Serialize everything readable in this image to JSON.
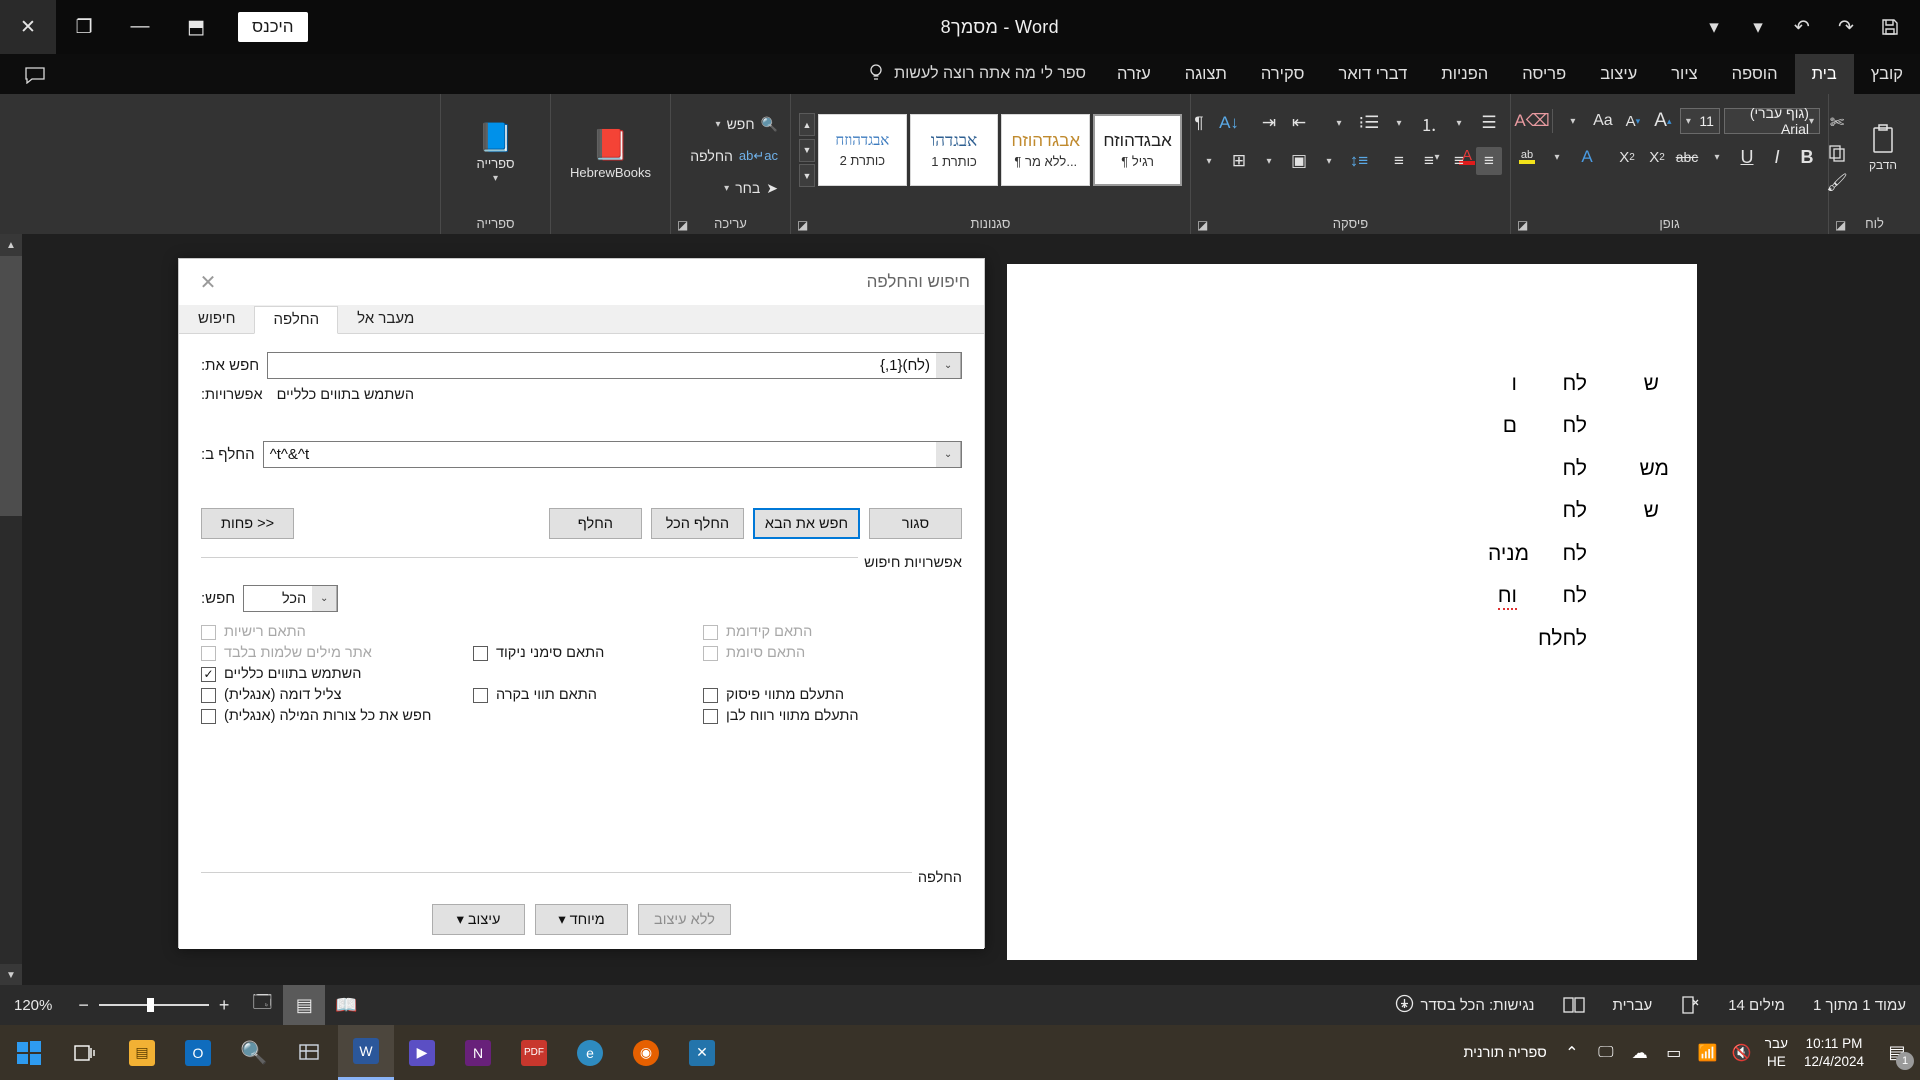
{
  "titlebar": {
    "title": "מסמך8 - Word",
    "signin_label": "היכנס",
    "buttons": {
      "close": "✕",
      "restore": "❐",
      "minimize": "—",
      "ribbon_display": "⬒"
    },
    "qat": {
      "save": "save-icon",
      "undo": "↶",
      "undo_drop": "▾",
      "redo": "↷",
      "customize": "▾"
    },
    "comment_icon": "comment-icon"
  },
  "ribbon_tabs": {
    "items": [
      {
        "label": "קובץ",
        "active": false
      },
      {
        "label": "בית",
        "active": true
      },
      {
        "label": "הוספה",
        "active": false
      },
      {
        "label": "ציור",
        "active": false
      },
      {
        "label": "עיצוב",
        "active": false
      },
      {
        "label": "פריסה",
        "active": false
      },
      {
        "label": "הפניות",
        "active": false
      },
      {
        "label": "דברי דואר",
        "active": false
      },
      {
        "label": "סקירה",
        "active": false
      },
      {
        "label": "תצוגה",
        "active": false
      },
      {
        "label": "עזרה",
        "active": false
      }
    ],
    "tellme": "ספר לי מה אתה רוצה לעשות"
  },
  "ribbon": {
    "groups": {
      "clipboard": {
        "label": "לוח",
        "paste_label": "הדבק",
        "cut_icon": "scissors-icon",
        "copy_icon": "copy-icon",
        "format_painter_icon": "format-painter-icon"
      },
      "font": {
        "label": "גופן",
        "font_name": "(גוף עברי) Arial",
        "font_size": "11",
        "grow_font": "A",
        "shrink_font": "A",
        "change_case": "Aa",
        "clear_formatting": "clear-formatting-icon",
        "bold": "B",
        "italic": "I",
        "underline": "U",
        "strikethrough": "abc",
        "subscript": "X₂",
        "superscript": "X²",
        "text_effects": "A",
        "highlight": "ab",
        "font_color": "A"
      },
      "paragraph": {
        "label": "פיסקה",
        "bullets_icon": "bullets-icon",
        "numbering_icon": "numbering-icon",
        "multilevel_icon": "multilevel-list-icon",
        "decrease_indent_icon": "decrease-indent-icon",
        "increase_indent_icon": "increase-indent-icon",
        "sort_icon": "sort-icon",
        "marks_icon": "¶",
        "align_right_icon": "align-right-icon",
        "align_center_icon": "align-center-icon",
        "align_left_icon": "align-left-icon",
        "justify_icon": "justify-icon",
        "line_spacing_icon": "line-spacing-icon",
        "shading_icon": "shading-icon",
        "borders_icon": "borders-icon",
        "rtl_icon": "rtl-icon"
      },
      "styles": {
        "label": "סגנונות",
        "gallery": [
          {
            "preview": "אבגדהוזח",
            "name": "¶ רגיל",
            "selected": true
          },
          {
            "preview": "אבגדהוזח",
            "name": "¶ ללא מר...",
            "selected": false
          },
          {
            "preview": "אבגדהו",
            "name": "כותרת 1",
            "selected": false
          },
          {
            "preview": "אבגדהוזח",
            "name": "כותרת 2",
            "selected": false
          }
        ],
        "scroll_up": "▲",
        "scroll_down": "▼",
        "more": "▼"
      },
      "editing": {
        "label": "עריכה",
        "items": [
          {
            "label": "חפש",
            "icon": "search-icon",
            "has_chevron": true
          },
          {
            "label": "החלפה",
            "icon": "replace-icon",
            "has_chevron": false
          },
          {
            "label": "בחר",
            "icon": "select-icon",
            "has_chevron": true
          }
        ]
      },
      "hebrewbooks": {
        "label": "",
        "title": "HebrewBooks",
        "icon": "book-icon"
      },
      "library": {
        "label": "ספרייה",
        "title": "ספרייה",
        "icon": "word-library-icon",
        "chevron": "▾"
      }
    }
  },
  "document": {
    "lines": [
      {
        "c1": "ש",
        "c2": "לח",
        "c3": "ו",
        "squiggle": false
      },
      {
        "c1": "",
        "c2": "לח",
        "c3": "ם",
        "squiggle": false
      },
      {
        "c1": "מש",
        "c2": "לח",
        "c3": "",
        "squiggle": false
      },
      {
        "c1": "ש",
        "c2": "לח",
        "c3": "",
        "squiggle": false
      },
      {
        "c1": "",
        "c2": "לח",
        "c3": "מניה",
        "squiggle": false
      },
      {
        "c1": "",
        "c2": "לח",
        "c3": "וח",
        "squiggle": true
      },
      {
        "c1": "",
        "c2": "לחלח",
        "c3": "",
        "squiggle": false
      }
    ]
  },
  "dialog": {
    "title": "חיפוש והחלפה",
    "close_icon": "close-icon",
    "tabs": [
      {
        "label": "חיפוש",
        "active": false
      },
      {
        "label": "החלפה",
        "active": true
      },
      {
        "label": "מעבר אל",
        "active": false
      }
    ],
    "find": {
      "label": "חפש את:",
      "value": "(לח){1,}",
      "dropdown_icon": "chevron-down-icon"
    },
    "options": {
      "label": "אפשרויות:",
      "value": "השתמש בתווים כלליים"
    },
    "replace": {
      "label": "החלף ב:",
      "value": "^t^&^t",
      "dropdown_icon": "chevron-down-icon"
    },
    "buttons": {
      "less": "<< פחות",
      "replace": "החלף",
      "replace_all": "החלף הכל",
      "find_next": "חפש את הבא",
      "close": "סגור"
    },
    "search_options_legend": "אפשרויות חיפוש",
    "search_scope": {
      "label": "חפש:",
      "value": "הכל",
      "dropdown_icon": "chevron-down-icon"
    },
    "checkboxes": [
      {
        "label": "התאם רישיות",
        "checked": false,
        "disabled": true,
        "col": "right"
      },
      {
        "label": "התאם קידומת",
        "checked": false,
        "disabled": true,
        "col": "left"
      },
      {
        "label": "אתר מילים שלמות בלבד",
        "checked": false,
        "disabled": true,
        "col": "right"
      },
      {
        "label": "התאם סימני ניקוד",
        "checked": false,
        "disabled": false,
        "col": "mid"
      },
      {
        "label": "התאם סיומת",
        "checked": false,
        "disabled": true,
        "col": "left"
      },
      {
        "label": "השתמש בתווים כלליים",
        "checked": true,
        "disabled": false,
        "col": "right"
      },
      {
        "label": "צליל דומה (אנגלית)",
        "checked": false,
        "disabled": false,
        "col": "right"
      },
      {
        "label": "התאם תווי בקרה",
        "checked": false,
        "disabled": false,
        "col": "mid"
      },
      {
        "label": "התעלם מתווי פיסוק",
        "checked": false,
        "disabled": false,
        "col": "left"
      },
      {
        "label": "חפש את כל צורות המילה (אנגלית)",
        "checked": false,
        "disabled": false,
        "col": "right"
      },
      {
        "label": "התעלם מתווי רווח לבן",
        "checked": false,
        "disabled": false,
        "col": "left"
      }
    ],
    "replace_legend": "החלפה",
    "bottom_buttons": {
      "format": "עיצוב ▾",
      "special": "מיוחד ▾",
      "no_formatting": "ללא עיצוב"
    },
    "checked_mark": "✓"
  },
  "statusbar": {
    "page": "עמוד 1 מתוך 1",
    "words": "14 מילים",
    "proofing_icon": "proofing-icon",
    "language": "עברית",
    "focus_icon": "focus-mode-icon",
    "accessibility": "נגישות: הכל בסדר",
    "accessibility_icon": "accessibility-icon",
    "views": {
      "read_mode": "read-mode-icon",
      "print_layout": "print-layout-icon",
      "web_layout": "web-layout-icon"
    },
    "zoom_out": "−",
    "zoom_in": "+",
    "zoom_level": "120%"
  },
  "taskbar": {
    "start_icon": "windows-start-icon",
    "taskview_icon": "task-view-icon",
    "apps": [
      {
        "name": "file-explorer-icon",
        "glyph": "🗂",
        "color": "#f7b731",
        "running": false
      },
      {
        "name": "outlook-icon",
        "glyph": "O",
        "color": "#0f6cbd",
        "running": false
      },
      {
        "name": "search-icon",
        "glyph": "🔍",
        "color": "#5b9bd5",
        "running": false
      },
      {
        "name": "screen-snip-icon",
        "glyph": "✂",
        "color": "#8e8e8e",
        "running": false
      },
      {
        "name": "word-icon",
        "glyph": "W",
        "color": "#2b579a",
        "running": true
      },
      {
        "name": "media-player-icon",
        "glyph": "▶",
        "color": "#7b68ee",
        "running": false
      },
      {
        "name": "vs-icon",
        "glyph": "N",
        "color": "#68217a",
        "running": false
      },
      {
        "name": "pdf-icon",
        "glyph": "P",
        "color": "#d93025",
        "running": false
      },
      {
        "name": "edge-icon",
        "glyph": "e",
        "color": "#2e8bc0",
        "running": false
      },
      {
        "name": "firefox-icon",
        "glyph": "◉",
        "color": "#e66000",
        "running": false
      },
      {
        "name": "vscode-icon",
        "glyph": "X",
        "color": "#0078d7",
        "running": false
      }
    ],
    "tray_label": "ספריה תורנית",
    "tray_chevron": "⌃",
    "tray_icons": [
      "display-icon",
      "onedrive-icon",
      "screen-icon",
      "wifi-icon",
      "volume-icon"
    ],
    "lang_line1": "עבר",
    "lang_line2": "HE",
    "clock_time": "10:11 PM",
    "clock_date": "12/4/2024",
    "notification_count": "1",
    "notification_icon": "notifications-icon"
  }
}
